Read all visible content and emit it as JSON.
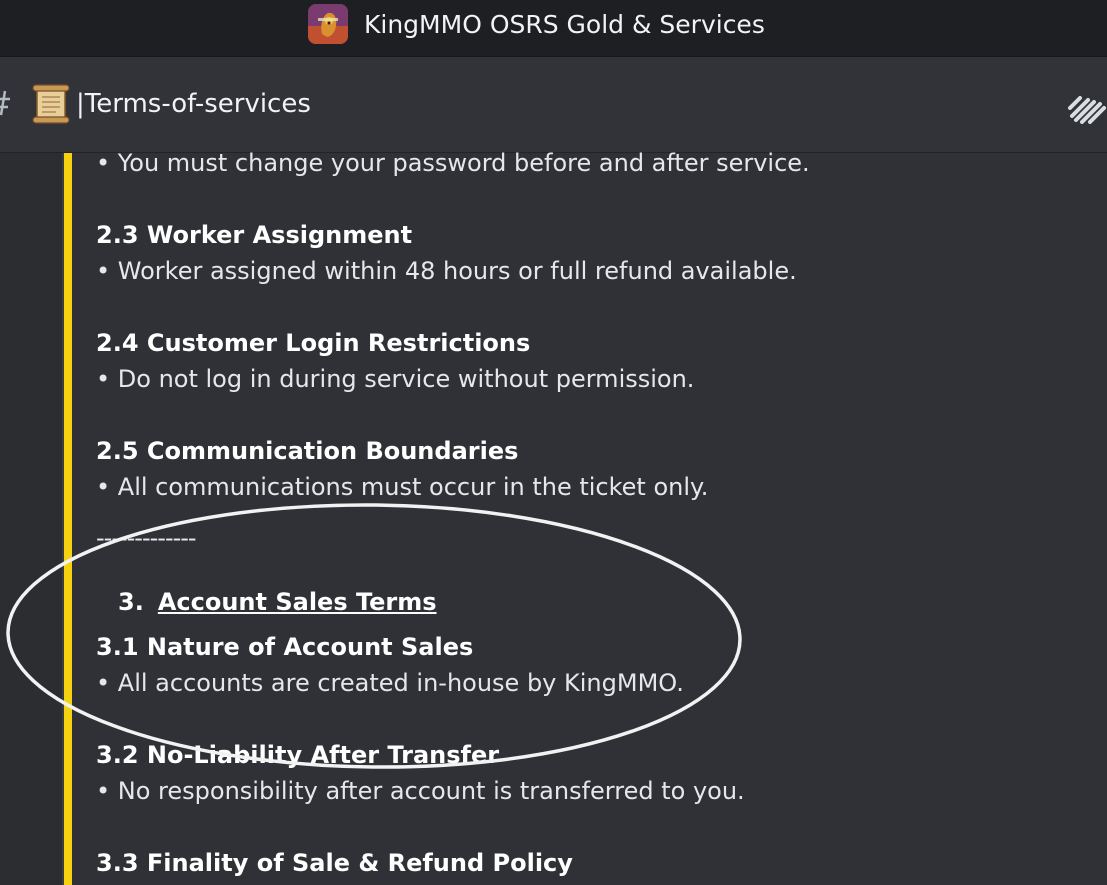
{
  "window": {
    "server_name": "KingMMO OSRS Gold & Services"
  },
  "channel": {
    "emoji_icon": "scroll-icon",
    "name": "|Terms-of-services"
  },
  "icons": {
    "channel_type": "hashtag-icon",
    "header_right": "threads-icon"
  },
  "colors": {
    "embed_accent": "#f5d10f",
    "background": "#2b2d31",
    "title_bar": "#1e1f22",
    "annotation_circle": "#f2f2f2"
  },
  "content": {
    "lines": [
      "• You must change your password before and after service.",
      "2.3 Worker Assignment",
      "• Worker assigned within 48 hours or full refund available.",
      "2.4 Customer Login Restrictions",
      "• Do not log in during service without permission.",
      "2.5 Communication Boundaries",
      "• All communications must occur in the ticket only.",
      "-------------"
    ],
    "section3": {
      "number": "3.",
      "title": "Account Sales Terms"
    },
    "lines2": [
      "3.1 Nature of Account Sales",
      "• All accounts are created in-house by KingMMO.",
      "3.2 No-Liability After Transfer",
      "• No responsibility after account is transferred to you.",
      "3.3 Finality of Sale & Refund Policy"
    ]
  }
}
